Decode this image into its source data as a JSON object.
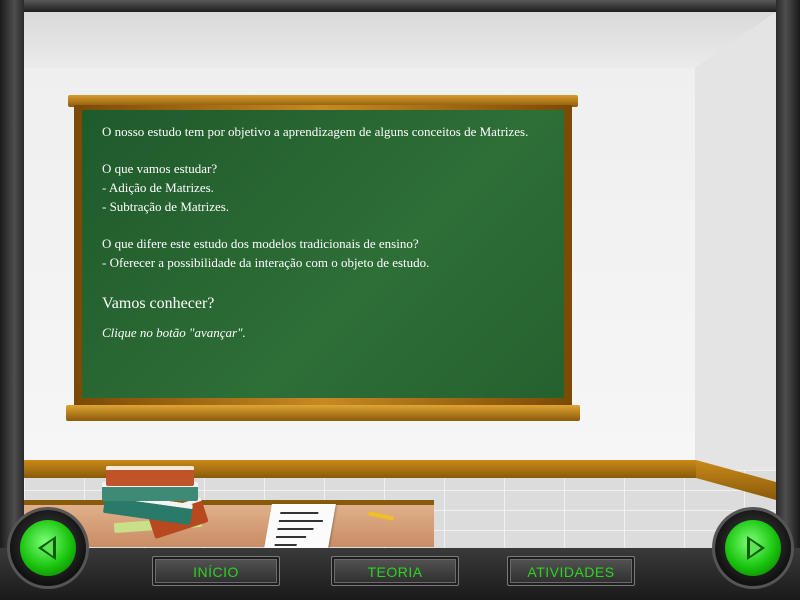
{
  "board": {
    "intro": "O nosso estudo tem por objetivo a aprendizagem de alguns conceitos de Matrizes.",
    "question1": "O que vamos estudar?",
    "items1": [
      "- Adição de Matrizes.",
      "- Subtração de Matrizes."
    ],
    "question2": "O que difere este estudo dos modelos tradicionais de ensino?",
    "items2": [
      "- Oferecer a possibilidade da interação com o objeto de estudo."
    ],
    "call_to_action": "Vamos conhecer?",
    "instruction": "Clique no botão \"avançar\"."
  },
  "nav": {
    "back_icon": "arrow-left-icon",
    "forward_icon": "arrow-right-icon",
    "menu": [
      {
        "id": "inicio",
        "label": "INÍCIO"
      },
      {
        "id": "teoria",
        "label": "TEORIA"
      },
      {
        "id": "atividades",
        "label": "ATIVIDADES"
      }
    ]
  },
  "colors": {
    "board": "#2a6834",
    "nav_green": "#19c40d",
    "menu_text": "#2bd51f",
    "wood": "#c68a22"
  }
}
